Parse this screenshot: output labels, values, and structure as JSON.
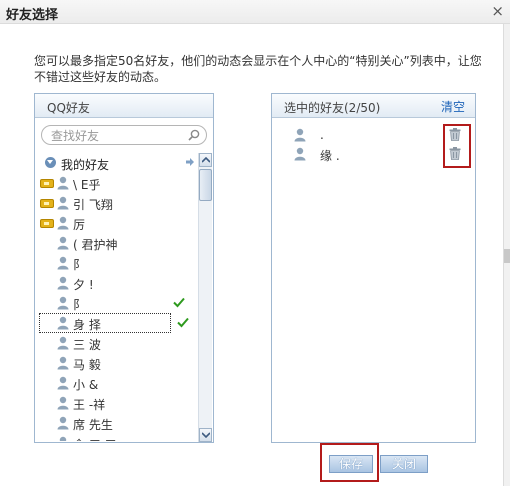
{
  "dialog": {
    "title": "好友选择",
    "close_glyph": "×",
    "description": "您可以最多指定50名好友，他们的动态会显示在个人中心的“特别关心”列表中，让您不错过这些好友的动态。"
  },
  "left_panel": {
    "title": "QQ好友",
    "search_placeholder": "查找好友",
    "group": {
      "label": "我的好友"
    },
    "friends": [
      {
        "name": "\\  E乎",
        "badge": true,
        "checked": false
      },
      {
        "name": "引  飞翔",
        "badge": true,
        "checked": false
      },
      {
        "name": "厉",
        "badge": true,
        "checked": false
      },
      {
        "name": "( 君护神",
        "badge": false,
        "checked": false
      },
      {
        "name": "阝",
        "badge": false,
        "checked": false
      },
      {
        "name": "夕 !",
        "badge": false,
        "checked": false
      },
      {
        "name": "阝",
        "badge": false,
        "checked": true
      },
      {
        "name": "身  择",
        "badge": false,
        "checked": true,
        "focused": true
      },
      {
        "name": "三  波",
        "badge": false,
        "checked": false
      },
      {
        "name": "马  毅",
        "badge": false,
        "checked": false
      },
      {
        "name": "小 &",
        "badge": false,
        "checked": false
      },
      {
        "name": "王  -祥",
        "badge": false,
        "checked": false
      },
      {
        "name": "席  先生",
        "badge": false,
        "checked": false
      },
      {
        "name": "余  三  三",
        "badge": false,
        "checked": false
      }
    ]
  },
  "right_panel": {
    "title": "选中的好友(2/50)",
    "clear_label": "清空",
    "selected": [
      {
        "name": "  ."
      },
      {
        "name": "缘 ."
      }
    ]
  },
  "buttons": {
    "save_label": "保存",
    "close_label": "关闭"
  },
  "colors": {
    "accent_link": "#1d63b8",
    "highlight_box": "#b31b1b",
    "check": "#2e9a1e"
  }
}
